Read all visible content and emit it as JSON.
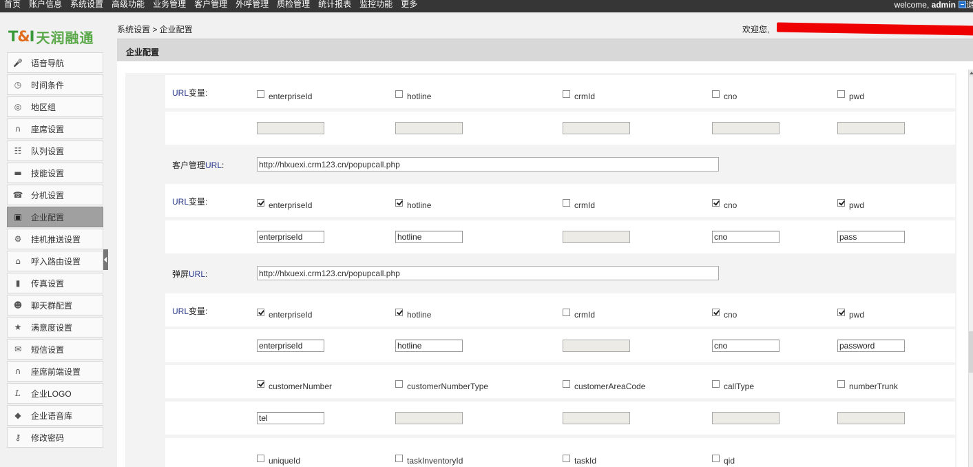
{
  "topnav": {
    "items": [
      "首页",
      "账户信息",
      "系统设置",
      "高级功能",
      "业务管理",
      "客户管理",
      "外呼管理",
      "质检管理",
      "统计报表",
      "监控功能",
      "更多"
    ]
  },
  "user": {
    "welcome_prefix": "welcome, ",
    "username": "admin",
    "logout_label": "退出"
  },
  "logo": {
    "mark_left": "T",
    "mark_amp": "&",
    "mark_right": "I",
    "text": "天润融通"
  },
  "sidebar": {
    "items": [
      {
        "label": "语音导航",
        "icon": "microphone-icon"
      },
      {
        "label": "时间条件",
        "icon": "clock-icon"
      },
      {
        "label": "地区组",
        "icon": "globe-icon"
      },
      {
        "label": "座席设置",
        "icon": "headset-icon"
      },
      {
        "label": "队列设置",
        "icon": "queue-icon"
      },
      {
        "label": "技能设置",
        "icon": "briefcase-icon"
      },
      {
        "label": "分机设置",
        "icon": "phone-icon"
      },
      {
        "label": "企业配置",
        "icon": "id-card-icon",
        "active": true
      },
      {
        "label": "挂机推送设置",
        "icon": "gear-icon"
      },
      {
        "label": "呼入路由设置",
        "icon": "router-icon"
      },
      {
        "label": "传真设置",
        "icon": "fax-icon"
      },
      {
        "label": "聊天群配置",
        "icon": "group-icon"
      },
      {
        "label": "满意度设置",
        "icon": "star-icon"
      },
      {
        "label": "短信设置",
        "icon": "envelope-icon"
      },
      {
        "label": "座席前端设置",
        "icon": "headset-front-icon"
      },
      {
        "label": "企业LOGO",
        "icon": "logo-icon"
      },
      {
        "label": "企业语音库",
        "icon": "cube-icon"
      },
      {
        "label": "修改密码",
        "icon": "key-icon"
      }
    ]
  },
  "breadcrumb": "系统设置 > 企业配置",
  "welcome_text": "欢迎您,",
  "panel_title": "企业配置",
  "labels": {
    "url_var_prefix": "URL",
    "url_var_suffix": "变量:",
    "crm_url_prefix": "客户管理",
    "crm_url_url": "URL",
    "crm_url_suffix": ":",
    "popup_url_prefix": "弹屏",
    "popup_url_url": "URL",
    "popup_url_suffix": ":"
  },
  "crm_url_value": "http://hlxuexi.crm123.cn/popupcall.php",
  "popup_url_value": "http://hlxuexi.crm123.cn/popupcall.php",
  "section1": {
    "vars": [
      {
        "label": "enterpriseId",
        "checked": false,
        "value": "",
        "disabled": true
      },
      {
        "label": "hotline",
        "checked": false,
        "value": "",
        "disabled": true
      },
      {
        "label": "crmId",
        "checked": false,
        "value": "",
        "disabled": true
      },
      {
        "label": "cno",
        "checked": false,
        "value": "",
        "disabled": true
      },
      {
        "label": "pwd",
        "checked": false,
        "value": "",
        "disabled": true
      }
    ]
  },
  "section2": {
    "vars": [
      {
        "label": "enterpriseId",
        "checked": true,
        "value": "enterpriseId",
        "disabled": false
      },
      {
        "label": "hotline",
        "checked": true,
        "value": "hotline",
        "disabled": false
      },
      {
        "label": "crmId",
        "checked": false,
        "value": "",
        "disabled": true
      },
      {
        "label": "cno",
        "checked": true,
        "value": "cno",
        "disabled": false
      },
      {
        "label": "pwd",
        "checked": true,
        "value": "pass",
        "disabled": false
      }
    ]
  },
  "section3": {
    "vars": [
      {
        "label": "enterpriseId",
        "checked": true,
        "value": "enterpriseId",
        "disabled": false
      },
      {
        "label": "hotline",
        "checked": true,
        "value": "hotline",
        "disabled": false
      },
      {
        "label": "crmId",
        "checked": false,
        "value": "",
        "disabled": true
      },
      {
        "label": "cno",
        "checked": true,
        "value": "cno",
        "disabled": false
      },
      {
        "label": "pwd",
        "checked": true,
        "value": "password",
        "disabled": false
      }
    ],
    "vars2": [
      {
        "label": "customerNumber",
        "checked": true,
        "value": "tel",
        "disabled": false
      },
      {
        "label": "customerNumberType",
        "checked": false,
        "value": "",
        "disabled": true
      },
      {
        "label": "customerAreaCode",
        "checked": false,
        "value": "",
        "disabled": true
      },
      {
        "label": "callType",
        "checked": false,
        "value": "",
        "disabled": true
      },
      {
        "label": "numberTrunk",
        "checked": false,
        "value": "",
        "disabled": true
      }
    ],
    "vars3": [
      {
        "label": "uniqueId",
        "checked": false
      },
      {
        "label": "taskInventoryId",
        "checked": false
      },
      {
        "label": "taskId",
        "checked": false
      },
      {
        "label": "qid",
        "checked": false
      }
    ]
  }
}
